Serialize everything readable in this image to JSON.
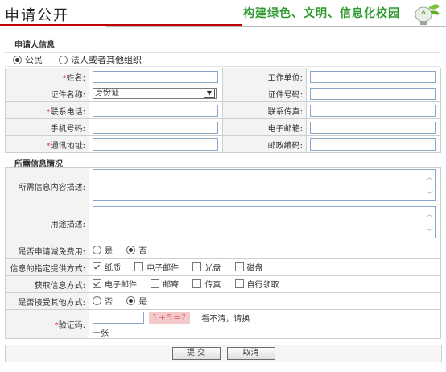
{
  "header": {
    "title": "申请公开",
    "slogan": "构建绿色、文明、信息化校园"
  },
  "applicant": {
    "section_title": "申请人信息",
    "types": [
      {
        "label": "公民",
        "selected": true
      },
      {
        "label": "法人或者其他组织",
        "selected": false
      }
    ],
    "fields": {
      "name": "姓名:",
      "work_unit": "工作单位:",
      "id_type": "证件名称:",
      "id_type_value": "身份证",
      "id_number": "证件号码:",
      "phone": "联系电话:",
      "fax": "联系传真:",
      "mobile": "手机号码:",
      "email": "电子邮箱:",
      "address": "通讯地址:",
      "postcode": "邮政编码:"
    }
  },
  "info": {
    "section_title": "所需信息情况",
    "content_desc": "所需信息内容描述:",
    "purpose_desc": "用途描述:",
    "fee_waiver": {
      "label": "是否申请减免费用:",
      "options": [
        {
          "label": "是",
          "selected": false
        },
        {
          "label": "否",
          "selected": true
        }
      ]
    },
    "provide_method": {
      "label": "信息的指定提供方式:",
      "options": [
        {
          "label": "纸质",
          "checked": true
        },
        {
          "label": "电子邮件",
          "checked": false
        },
        {
          "label": "光盘",
          "checked": false
        },
        {
          "label": "磁盘",
          "checked": false
        }
      ]
    },
    "obtain_method": {
      "label": "获取信息方式:",
      "options": [
        {
          "label": "电子邮件",
          "checked": true
        },
        {
          "label": "邮寄",
          "checked": false
        },
        {
          "label": "传真",
          "checked": false
        },
        {
          "label": "自行领取",
          "checked": false
        }
      ]
    },
    "accept_other": {
      "label": "是否接受其他方式:",
      "options": [
        {
          "label": "否",
          "selected": false
        },
        {
          "label": "是",
          "selected": true
        }
      ]
    },
    "captcha": {
      "label": "验证码:",
      "image_text": "1+5=?",
      "refresh_text_1": "看不清，请换",
      "refresh_text_2": "一张"
    }
  },
  "actions": {
    "submit": "提 交",
    "cancel": "取消"
  },
  "colors": {
    "accent_red": "#c00000",
    "slogan_green": "#2e9a2e",
    "required": "#e03030"
  }
}
